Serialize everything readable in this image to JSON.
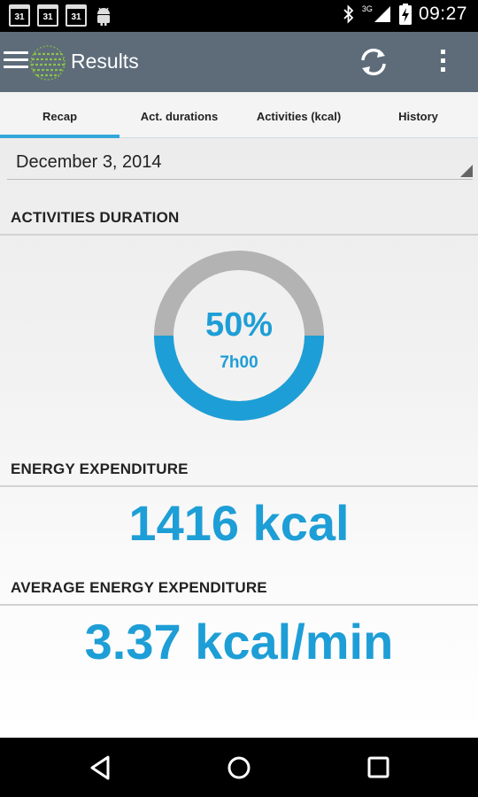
{
  "status_bar": {
    "calendar_icons": [
      "31",
      "31",
      "31"
    ],
    "network": "3G",
    "time": "09:27"
  },
  "action_bar": {
    "title": "Results"
  },
  "tabs": [
    {
      "label": "Recap",
      "active": true
    },
    {
      "label": "Act. durations",
      "active": false
    },
    {
      "label": "Activities (kcal)",
      "active": false
    },
    {
      "label": "History",
      "active": false
    }
  ],
  "date_selector": {
    "value": "December 3, 2014"
  },
  "activities_duration": {
    "heading": "ACTIVITIES DURATION",
    "percent_text": "50%",
    "percent_value": 50,
    "duration": "7h00",
    "colors": {
      "fill": "#1e9ed6",
      "track": "#b3b3b3"
    }
  },
  "energy_expenditure": {
    "heading": "ENERGY EXPENDITURE",
    "value": "1416 kcal"
  },
  "average_energy_expenditure": {
    "heading": "AVERAGE ENERGY EXPENDITURE",
    "value": "3.37 kcal/min"
  },
  "colors": {
    "accent": "#1e9ed6",
    "action_bar": "#5e6c7a",
    "tab_indicator": "#33a7dc"
  }
}
